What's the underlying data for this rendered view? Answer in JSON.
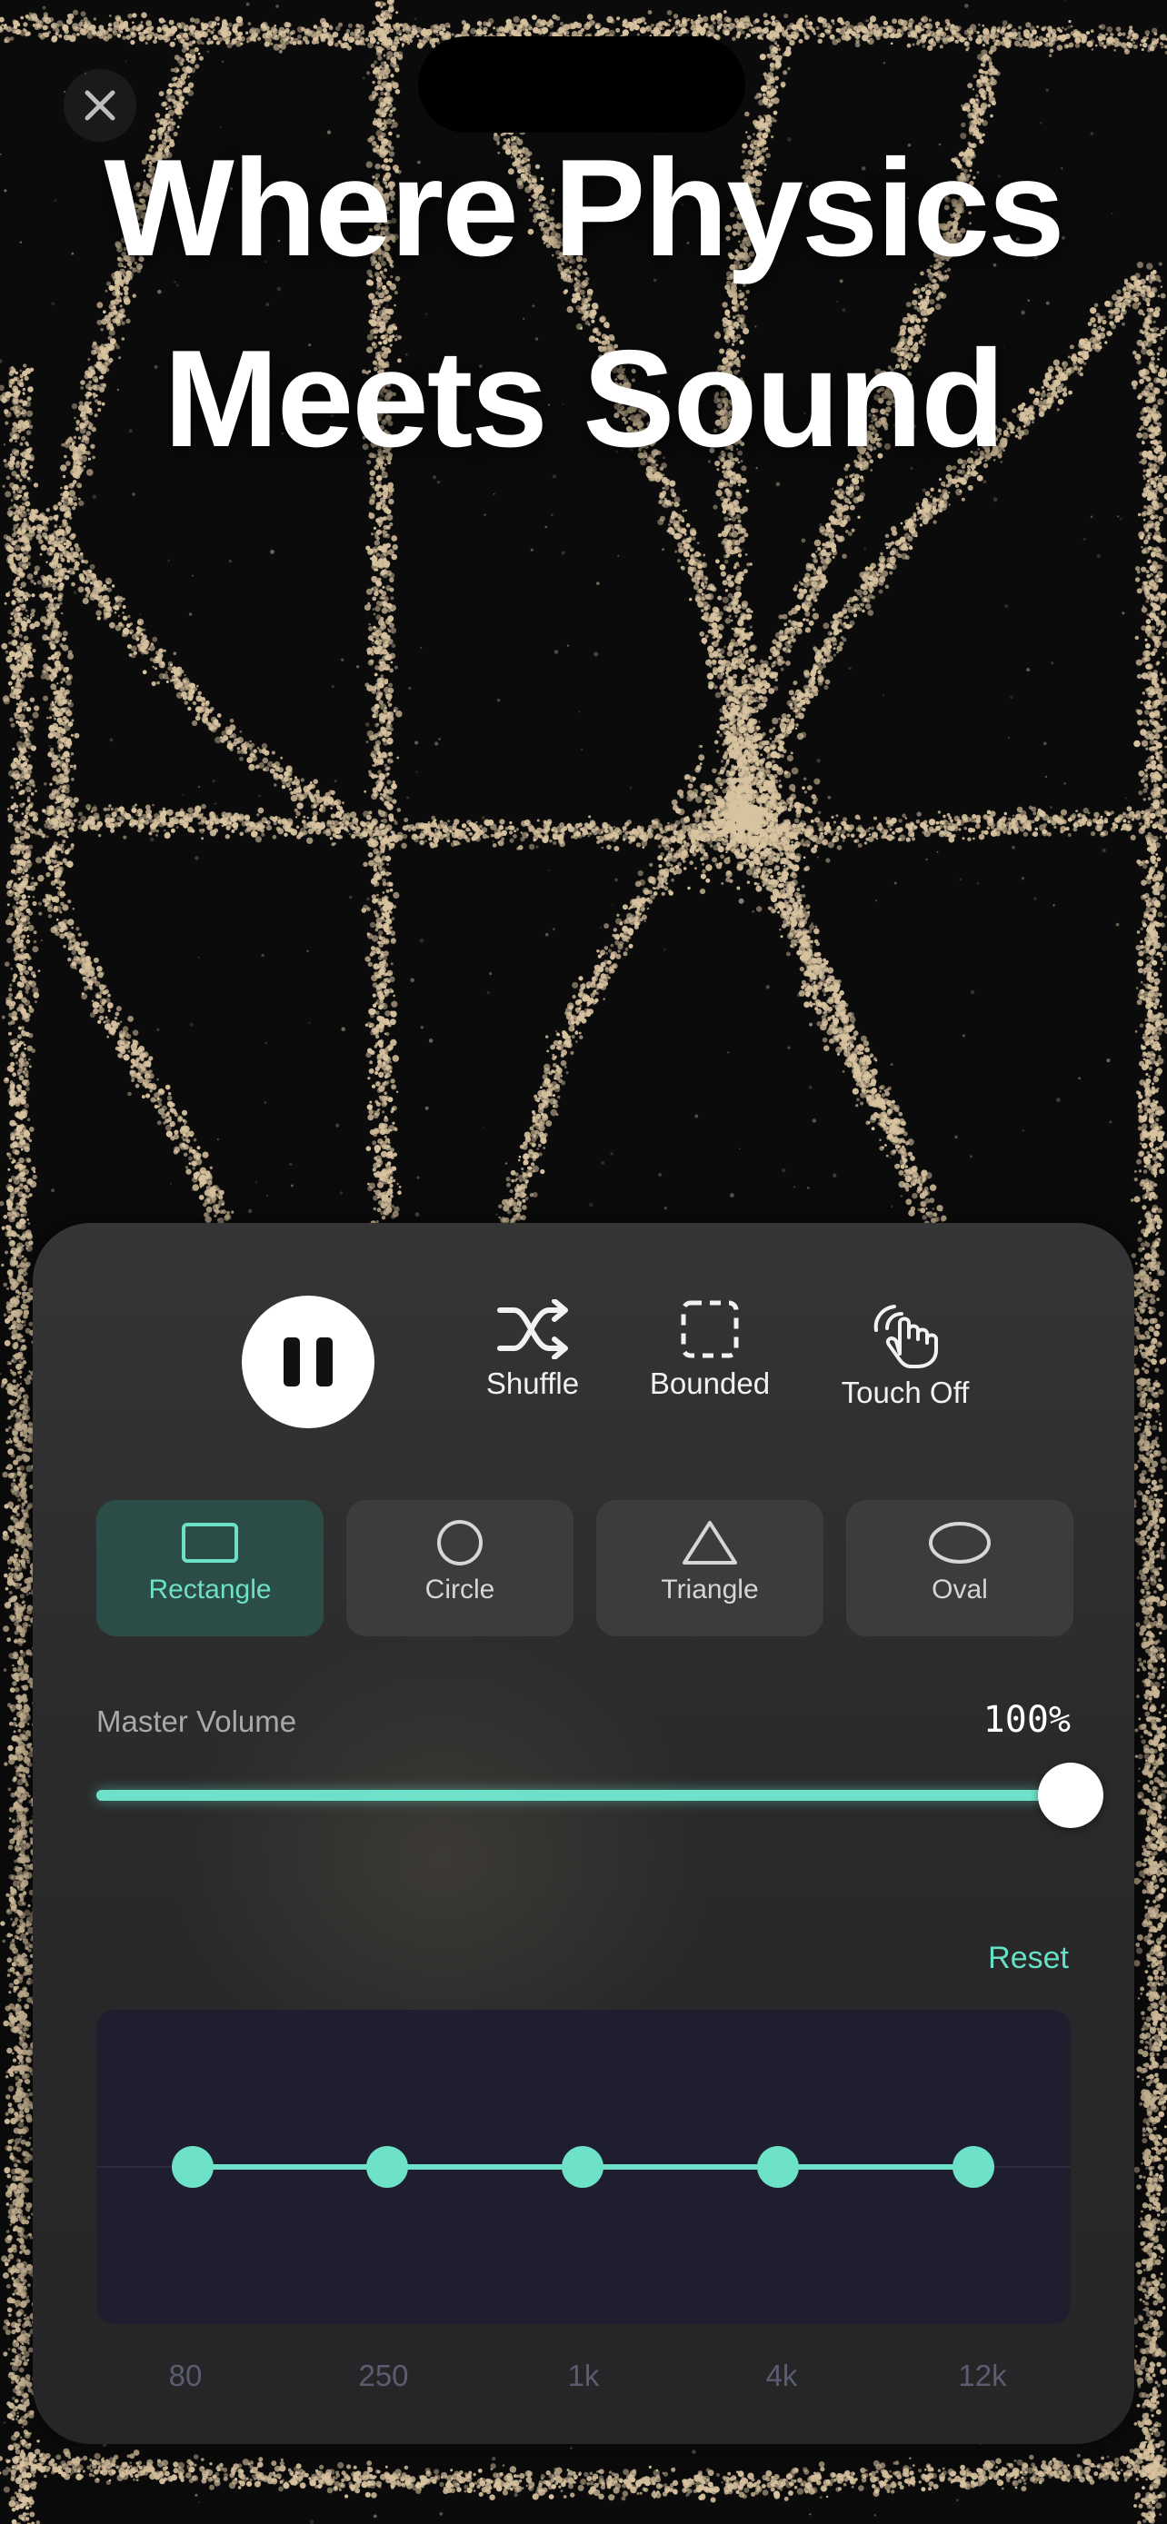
{
  "hero": {
    "line1": "Where Physics",
    "line2": "Meets Sound"
  },
  "close_icon": "close-icon",
  "transport": {
    "play_pause": {
      "state": "playing",
      "icon": "pause-icon"
    },
    "buttons": [
      {
        "label": "Shuffle",
        "icon": "shuffle-icon"
      },
      {
        "label": "Bounded",
        "icon": "dashed-square-icon"
      },
      {
        "label": "Touch Off",
        "icon": "hand-tap-icon"
      }
    ]
  },
  "shapes": [
    {
      "label": "Rectangle",
      "icon": "rectangle-icon",
      "selected": true
    },
    {
      "label": "Circle",
      "icon": "circle-icon",
      "selected": false
    },
    {
      "label": "Triangle",
      "icon": "triangle-icon",
      "selected": false
    },
    {
      "label": "Oval",
      "icon": "oval-icon",
      "selected": false
    }
  ],
  "volume": {
    "label": "Master Volume",
    "value_text": "100%",
    "value": 1.0
  },
  "eq": {
    "reset_label": "Reset",
    "bands": [
      {
        "label": "80",
        "gain": 0
      },
      {
        "label": "250",
        "gain": 0
      },
      {
        "label": "1k",
        "gain": 0
      },
      {
        "label": "4k",
        "gain": 0
      },
      {
        "label": "12k",
        "gain": 0
      }
    ]
  },
  "colors": {
    "accent": "#6de2c9",
    "sand": "#d8c3a0",
    "background": "#0b0b0c"
  }
}
